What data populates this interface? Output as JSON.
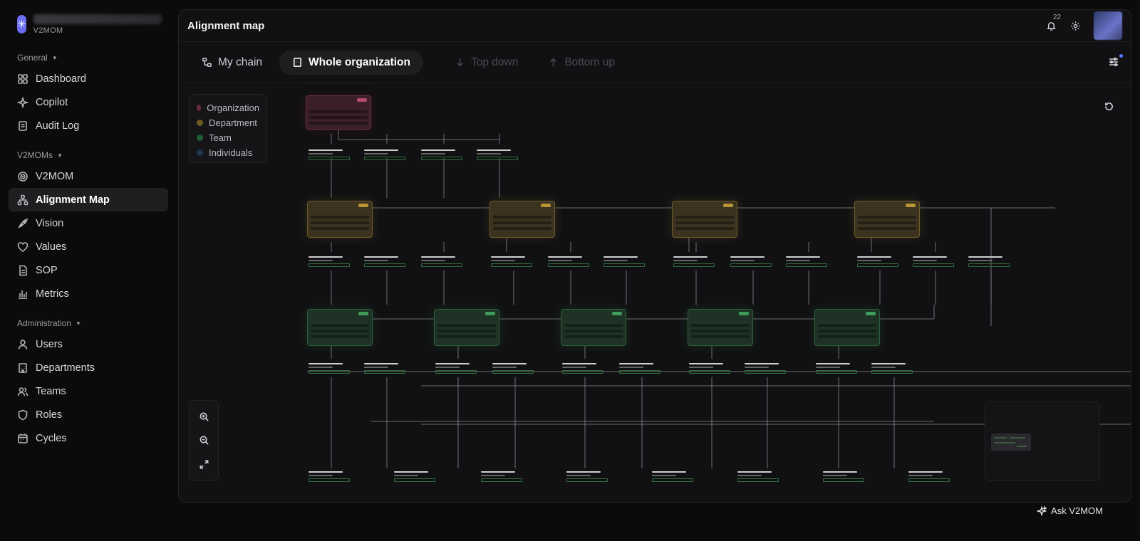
{
  "brand": {
    "subtitle": "V2MOM"
  },
  "sidebar": {
    "sections": [
      {
        "label": "General",
        "items": [
          "Dashboard",
          "Copilot",
          "Audit Log"
        ]
      },
      {
        "label": "V2MOMs",
        "items": [
          "V2MOM",
          "Alignment Map",
          "Vision",
          "Values",
          "SOP",
          "Metrics"
        ]
      },
      {
        "label": "Administration",
        "items": [
          "Users",
          "Departments",
          "Teams",
          "Roles",
          "Cycles"
        ]
      }
    ],
    "active": "Alignment Map"
  },
  "header": {
    "title": "Alignment map",
    "notification_count": "22"
  },
  "tabs": {
    "my_chain": "My chain",
    "whole_org": "Whole organization",
    "top_down": "Top down",
    "bottom_up": "Bottom up"
  },
  "legend": {
    "items": [
      {
        "label": "Organization",
        "color": "#6b2a3b"
      },
      {
        "label": "Department",
        "color": "#6b5a22"
      },
      {
        "label": "Team",
        "color": "#1f5b33"
      },
      {
        "label": "Individuals",
        "color": "#22344f"
      }
    ]
  },
  "ask_button": "Ask V2MOM",
  "icons": {
    "logo": "asterisk-icon",
    "bell": "bell-icon",
    "gear": "gear-icon",
    "filter": "sliders-icon",
    "reset": "rotate-ccw-icon",
    "zoom_in": "zoom-in-icon",
    "zoom_out": "zoom-out-icon",
    "fit": "fullscreen-icon",
    "ask": "sparkle-icon"
  },
  "colors": {
    "accent": "#6b6cf0",
    "org": "#b84a6a",
    "department": "#b99535",
    "team": "#3f9c5a"
  }
}
